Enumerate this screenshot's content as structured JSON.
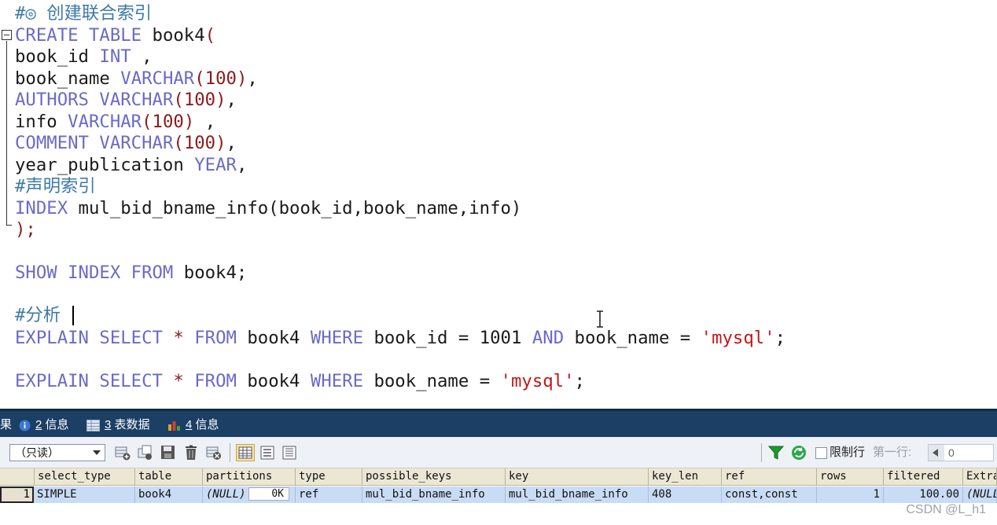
{
  "editor": {
    "comment_create": "#◎ 创建联合索引",
    "create_kw": "CREATE TABLE",
    "table_name": "book4",
    "open_paren": "(",
    "col1_name": "book_id",
    "col1_type": "INT",
    "col1_tail": " ,",
    "col2_name": "book_name",
    "col3_name": "AUTHORS",
    "col4_name": "info",
    "col5_name": "COMMENT",
    "varchar_kw": "VARCHAR",
    "len_100": "100",
    "col6_name": "year_publication",
    "col6_type": "YEAR",
    "comment_index": "#声明索引",
    "index_kw": "INDEX",
    "index_def": " mul_bid_bname_info(book_id,book_name,info)",
    "close_stmt": ");",
    "show_kw": "SHOW INDEX FROM",
    "show_tail": " book4;",
    "comment_analyze": "#分析",
    "explain_kw": "EXPLAIN",
    "select_kw": "SELECT",
    "star": " * ",
    "from_kw": "FROM",
    "from_table": " book4 ",
    "where_kw": "WHERE",
    "cond1": " book_id = ",
    "num_1001": "1001",
    "and_kw": "AND",
    "cond2": " book_name = ",
    "str_mysql": "'mysql'",
    "semicolon": ";"
  },
  "tabs": [
    {
      "label_prefix": "果",
      "num": "",
      "text": ""
    },
    {
      "num": "2",
      "text": " 信息"
    },
    {
      "num": "3",
      "text": " 表数据"
    },
    {
      "num": "4",
      "text": " 信息"
    }
  ],
  "toolbar": {
    "readonly_select": "（只读）",
    "limit_label": "限制行",
    "first_row_label": "第一行:",
    "first_row_value": "0"
  },
  "grid": {
    "columns": [
      "select_type",
      "table",
      "partitions",
      "type",
      "possible_keys",
      "key",
      "key_len",
      "ref",
      "rows",
      "filtered",
      "Extra"
    ],
    "row": {
      "rownum": "1",
      "select_type": "SIMPLE",
      "table": "book4",
      "partitions": "(NULL)",
      "ok": "0K",
      "type": "ref",
      "possible_keys": "mul_bid_bname_info",
      "key": "mul_bid_bname_info",
      "key_len": "408",
      "ref": "const,const",
      "rows": "1",
      "filtered": "100.00",
      "Extra": "(NULL)"
    }
  },
  "watermark": "CSDN @L_h1",
  "colors": {
    "keyword": "#6a6ac8",
    "number": "#8b1a1a",
    "string": "#c01818",
    "tabbar": "#1c3f66"
  }
}
